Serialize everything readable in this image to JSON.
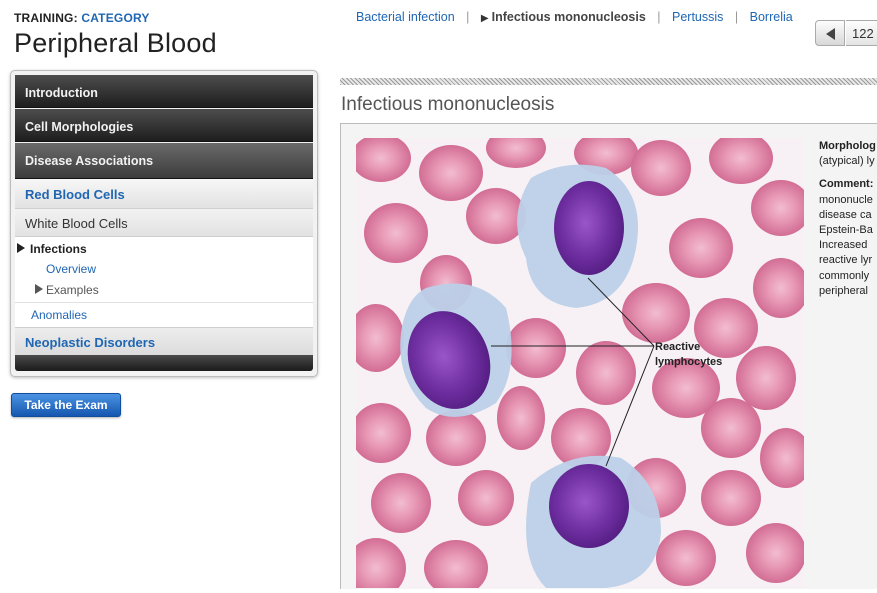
{
  "header": {
    "training_label": "TRAINING:",
    "category_label": "CATEGORY",
    "title": "Peripheral Blood"
  },
  "breadcrumb": {
    "items": [
      "Bacterial infection",
      "Infectious mononucleosis",
      "Pertussis",
      "Borrelia"
    ],
    "current_index": 1
  },
  "pager": {
    "page": "122"
  },
  "sidebar": {
    "sections": [
      "Introduction",
      "Cell Morphologies",
      "Disease Associations"
    ],
    "red_blood_cells": "Red Blood Cells",
    "white_blood_cells": "White Blood Cells",
    "infections": "Infections",
    "overview": "Overview",
    "examples": "Examples",
    "anomalies": "Anomalies",
    "neoplastic": "Neoplastic Disorders"
  },
  "exam_button": "Take the Exam",
  "content": {
    "section_title": "Infectious mononucleosis",
    "image_label_line1": "Reactive",
    "image_label_line2": "lymphocytes",
    "morph_lines": [
      "Morpholog",
      "(atypical) ly"
    ],
    "comment_label": "Comment:",
    "comment_lines": [
      "mononucle",
      "disease ca",
      "Epstein-Ba",
      "Increased",
      "reactive lyr",
      "commonly",
      "peripheral"
    ]
  },
  "colors": {
    "link_blue": "#1f66b3",
    "nav_dark": "#2a2a2a",
    "button_blue": "#1a5fb4",
    "rbc_pink": "#d77f9d",
    "nucleus_purple": "#6a2a99",
    "cytoplasm_blue": "#b9cde6"
  }
}
